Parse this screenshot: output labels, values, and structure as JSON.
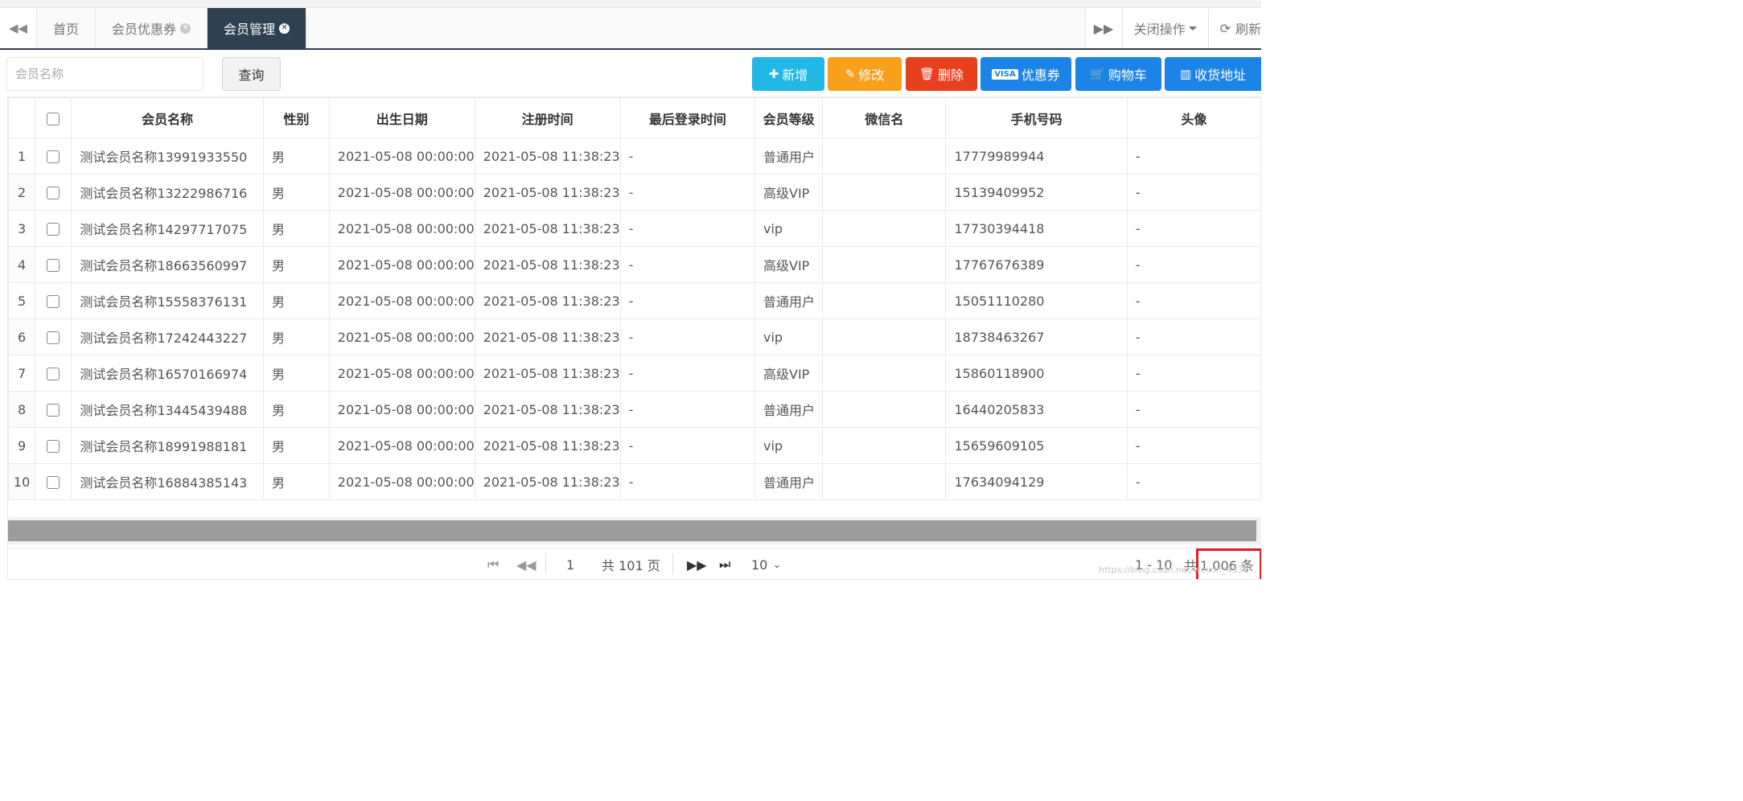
{
  "tabbar": {
    "tabs": [
      {
        "label": "首页",
        "closable": false,
        "active": false
      },
      {
        "label": "会员优惠券",
        "closable": true,
        "active": false
      },
      {
        "label": "会员管理",
        "closable": true,
        "active": true
      }
    ],
    "close_ops_label": "关闭操作",
    "refresh_label": "刷新"
  },
  "toolbar": {
    "search_placeholder": "会员名称",
    "query_label": "查询",
    "buttons": [
      {
        "label": "新增",
        "icon": "plus-icon",
        "color": "#23b7e5"
      },
      {
        "label": "修改",
        "icon": "edit-icon",
        "color": "#f8ac59"
      },
      {
        "label": "删除",
        "icon": "trash-icon",
        "color": "#ed5565"
      },
      {
        "label": "优惠券",
        "icon": "visa-card-icon",
        "color": "#1c84c6"
      },
      {
        "label": "购物车",
        "icon": "cart-icon",
        "color": "#1c84c6"
      },
      {
        "label": "收货地址",
        "icon": "map-icon",
        "color": "#1c84c6"
      }
    ]
  },
  "table": {
    "headers": [
      "会员名称",
      "性别",
      "出生日期",
      "注册时间",
      "最后登录时间",
      "会员等级",
      "微信名",
      "手机号码",
      "头像"
    ],
    "rows": [
      {
        "idx": "1",
        "name": "测试会员名称13991933550",
        "gender": "男",
        "birth": "2021-05-08 00:00:00",
        "reg": "2021-05-08 11:38:23",
        "last": "-",
        "level": "普通用户",
        "wechat": "",
        "phone": "17779989944",
        "avatar": "-"
      },
      {
        "idx": "2",
        "name": "测试会员名称13222986716",
        "gender": "男",
        "birth": "2021-05-08 00:00:00",
        "reg": "2021-05-08 11:38:23",
        "last": "-",
        "level": "高级VIP",
        "wechat": "",
        "phone": "15139409952",
        "avatar": "-"
      },
      {
        "idx": "3",
        "name": "测试会员名称14297717075",
        "gender": "男",
        "birth": "2021-05-08 00:00:00",
        "reg": "2021-05-08 11:38:23",
        "last": "-",
        "level": "vip",
        "wechat": "",
        "phone": "17730394418",
        "avatar": "-"
      },
      {
        "idx": "4",
        "name": "测试会员名称18663560997",
        "gender": "男",
        "birth": "2021-05-08 00:00:00",
        "reg": "2021-05-08 11:38:23",
        "last": "-",
        "level": "高级VIP",
        "wechat": "",
        "phone": "17767676389",
        "avatar": "-"
      },
      {
        "idx": "5",
        "name": "测试会员名称15558376131",
        "gender": "男",
        "birth": "2021-05-08 00:00:00",
        "reg": "2021-05-08 11:38:23",
        "last": "-",
        "level": "普通用户",
        "wechat": "",
        "phone": "15051110280",
        "avatar": "-"
      },
      {
        "idx": "6",
        "name": "测试会员名称17242443227",
        "gender": "男",
        "birth": "2021-05-08 00:00:00",
        "reg": "2021-05-08 11:38:23",
        "last": "-",
        "level": "vip",
        "wechat": "",
        "phone": "18738463267",
        "avatar": "-"
      },
      {
        "idx": "7",
        "name": "测试会员名称16570166974",
        "gender": "男",
        "birth": "2021-05-08 00:00:00",
        "reg": "2021-05-08 11:38:23",
        "last": "-",
        "level": "高级VIP",
        "wechat": "",
        "phone": "15860118900",
        "avatar": "-"
      },
      {
        "idx": "8",
        "name": "测试会员名称13445439488",
        "gender": "男",
        "birth": "2021-05-08 00:00:00",
        "reg": "2021-05-08 11:38:23",
        "last": "-",
        "level": "普通用户",
        "wechat": "",
        "phone": "16440205833",
        "avatar": "-"
      },
      {
        "idx": "9",
        "name": "测试会员名称18991988181",
        "gender": "男",
        "birth": "2021-05-08 00:00:00",
        "reg": "2021-05-08 11:38:23",
        "last": "-",
        "level": "vip",
        "wechat": "",
        "phone": "15659609105",
        "avatar": "-"
      },
      {
        "idx": "10",
        "name": "测试会员名称16884385143",
        "gender": "男",
        "birth": "2021-05-08 00:00:00",
        "reg": "2021-05-08 11:38:23",
        "last": "-",
        "level": "普通用户",
        "wechat": "",
        "phone": "17634094129",
        "avatar": "-"
      }
    ]
  },
  "pager": {
    "current_page": "1",
    "total_pages_label": "共 101 页",
    "page_size": "10",
    "range_label": "1 - 10",
    "total_prefix": "共",
    "total_count": "1,006 条",
    "watermark": "https://blog.csdn.net/weixin_4332..."
  }
}
